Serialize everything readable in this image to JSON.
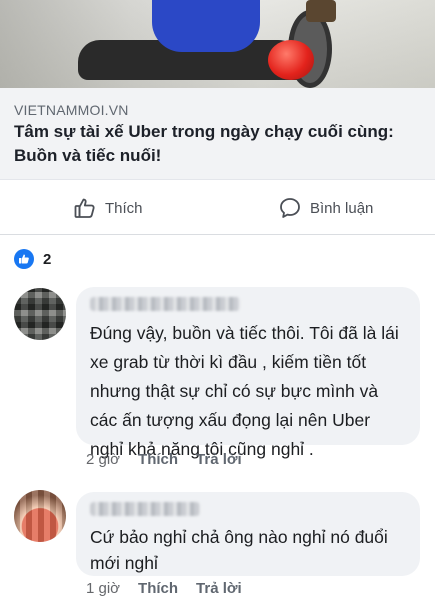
{
  "post": {
    "link_domain": "VIETNAMMOI.VN",
    "link_title": "Tâm sự tài xế Uber trong ngày chạy cuối cùng: Buồn và tiếc nuối!"
  },
  "actions": {
    "like_label": "Thích",
    "like_icon": "thumbs-up-icon",
    "comment_label": "Bình luận",
    "comment_icon": "comment-bubble-icon"
  },
  "reactions": {
    "count": "2",
    "color": "#1877f2"
  },
  "comments": [
    {
      "author": "",
      "text": "Đúng vậy, buồn và tiếc thôi. Tôi đã là lái xe grab từ thời kì đầu , kiếm tiền tốt nhưng thật sự chỉ có sự bực mình và các ấn tượng xấu đọng lại nên Uber nghỉ khả năng tôi cũng nghỉ .",
      "time": "2 giờ",
      "like_label": "Thích",
      "reply_label": "Trả lời"
    },
    {
      "author": "",
      "text": "Cứ bảo nghỉ chả ông nào nghỉ nó đuổi mới nghỉ",
      "time": "1 giờ",
      "like_label": "Thích",
      "reply_label": "Trả lời"
    }
  ]
}
